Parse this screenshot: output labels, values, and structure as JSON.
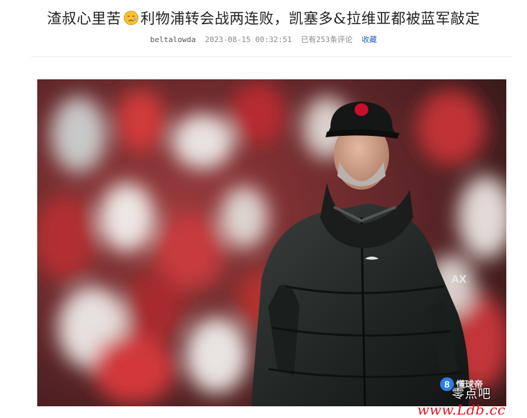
{
  "article": {
    "title_part1": "渣叔心里苦",
    "title_part2": "利物浦转会战两连败，凯塞多&拉维亚都被蓝军敲定",
    "author": "beltalowda",
    "datetime": "2023-08-15 00:32:51",
    "comments": "已有253条评论",
    "favorite_label": "收藏",
    "emoji_icon": "sad-face-emoji"
  },
  "watermark": {
    "badge_number": "8",
    "badge_text": "懂球帝",
    "site_name": "零点吧",
    "url": "www.Ldb.cc"
  }
}
